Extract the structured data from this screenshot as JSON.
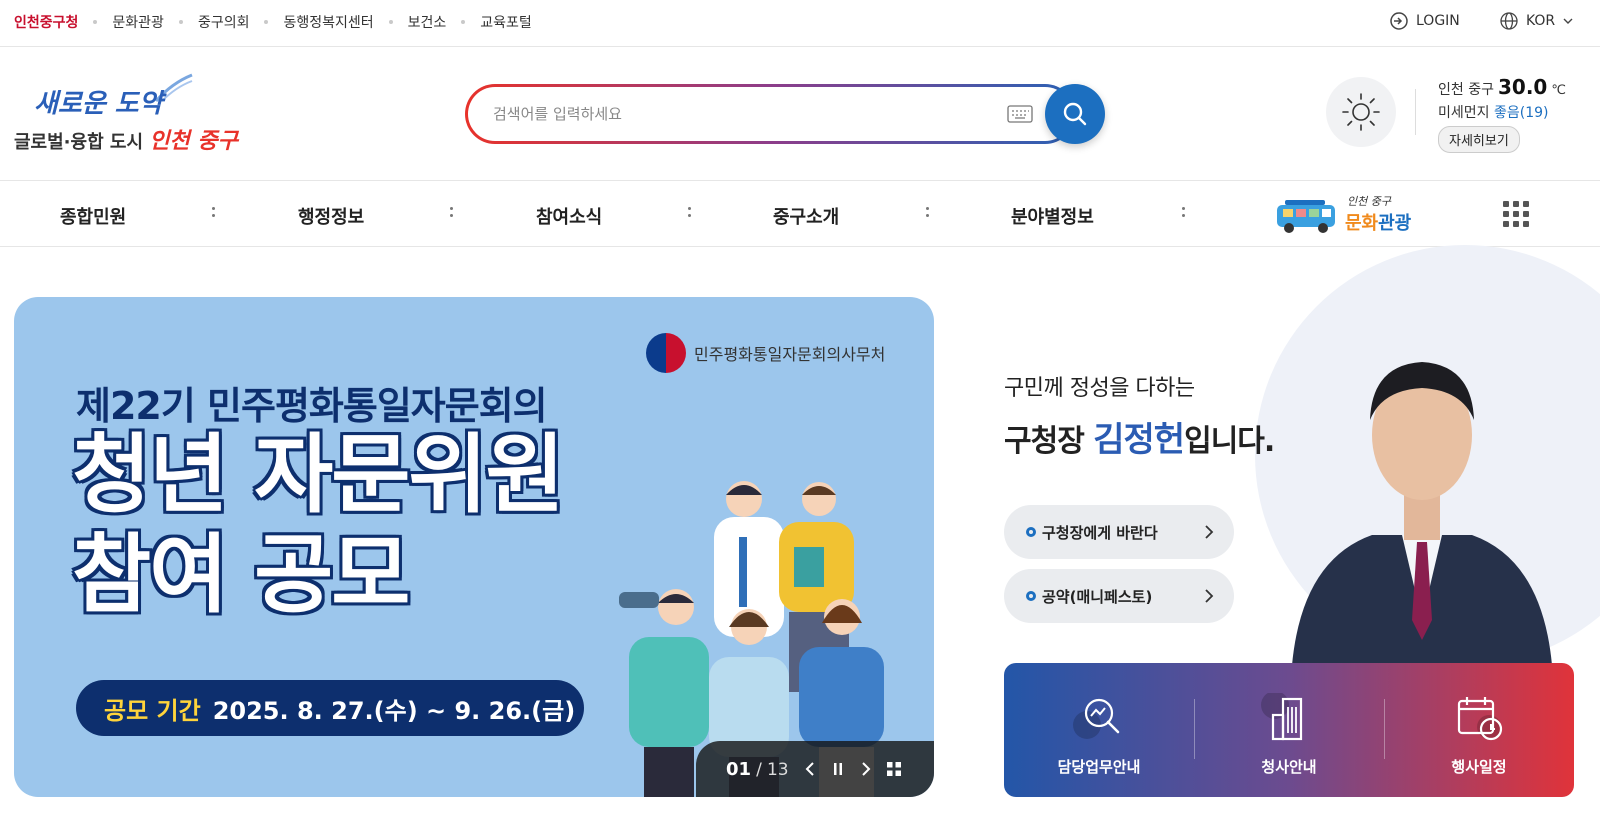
{
  "topbar": {
    "sites": [
      "인천중구청",
      "문화관광",
      "중구의회",
      "동행정복지센터",
      "보건소",
      "교육포털"
    ],
    "login": "LOGIN",
    "lang": "KOR"
  },
  "logo": {
    "line1": "새로운 도약",
    "line2a": "글로벌·융합 도시 ",
    "line2b": "인천 중구"
  },
  "search": {
    "placeholder": "검색어를 입력하세요"
  },
  "weather": {
    "location": "인천 중구",
    "temp": "30.0",
    "unit": "℃",
    "dust_label": "미세먼지",
    "dust_value": "좋음(19)",
    "more": "자세히보기"
  },
  "gnb": {
    "items": [
      "종합민원",
      "행정정보",
      "참여소식",
      "중구소개",
      "분야별정보"
    ],
    "culture_small": "인천 중구",
    "culture_a": "문화",
    "culture_b": "관광"
  },
  "banner": {
    "org": "민주평화통일자문회의사무처",
    "subtitle": "제22기 민주평화통일자문회의",
    "title1": "청년 자문위원",
    "title2": "참여 공모",
    "period_label": "공모 기간",
    "period_value": "2025. 8. 27.(수) ~ 9. 26.(금)",
    "current": "01",
    "separator": "/",
    "total": "13"
  },
  "mayor": {
    "line1": "구민께 정성을 다하는",
    "prefix": "구청장 ",
    "name": "김정헌",
    "suffix": "입니다.",
    "link1": "구청장에게 바란다",
    "link2": "공약(매니페스토)"
  },
  "quick": [
    "담당업무안내",
    "청사안내",
    "행사일정"
  ],
  "colors": {
    "brand_red": "#c8102e",
    "brand_blue": "#1c6fc0",
    "banner_bg": "#9cc6ec",
    "navy": "#0d2f6e"
  }
}
